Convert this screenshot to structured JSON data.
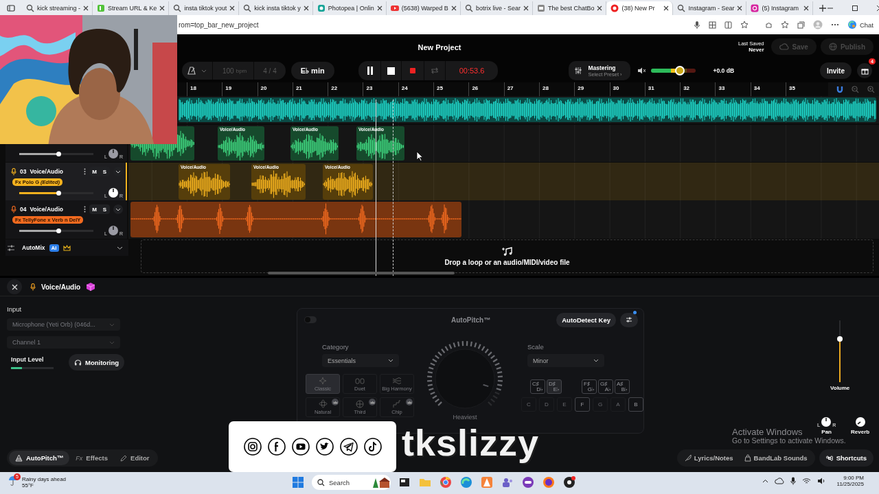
{
  "browser": {
    "tabs": [
      {
        "label": "kick streaming -",
        "selected": false
      },
      {
        "label": "Stream URL & Ke",
        "selected": false
      },
      {
        "label": "insta tiktok yout",
        "selected": false
      },
      {
        "label": "kick insta tiktok y",
        "selected": false
      },
      {
        "label": "Photopea | Onlin",
        "selected": false
      },
      {
        "label": "(5638) Warped B",
        "selected": false
      },
      {
        "label": "botrix live - Sear",
        "selected": false
      },
      {
        "label": "The best ChatBo",
        "selected": false
      },
      {
        "label": "(38) New Pr",
        "selected": true
      },
      {
        "label": "Instagram - Sear",
        "selected": false
      },
      {
        "label": "(5) Instagram",
        "selected": false
      }
    ],
    "address": "rom=top_bar_new_project",
    "chat": "Chat"
  },
  "project": {
    "title": "New Project",
    "last_saved_label": "Last Saved",
    "last_saved": "Never",
    "save": "Save",
    "publish": "Publish",
    "invite": "Invite",
    "gift_count": "4"
  },
  "transport": {
    "tempo": "100",
    "tempo_unit": "bpm",
    "meter": "4 / 4",
    "key": "E♭ min",
    "playing": true,
    "time": "00:53.6"
  },
  "mastering": {
    "label": "Mastering",
    "preset": "Select Preset ›"
  },
  "master_volume": {
    "level": 0.65,
    "reading": "+0.0 dB"
  },
  "ruler": [
    "18",
    "19",
    "20",
    "21",
    "22",
    "23",
    "24",
    "25",
    "26",
    "27",
    "28",
    "29",
    "30",
    "31",
    "32",
    "33",
    "34",
    "35"
  ],
  "tracks": [
    {
      "color": "#1fd6c9",
      "selected": false,
      "clips": [
        {
          "kind": "audio"
        }
      ]
    },
    {
      "color": "#3fd37e",
      "selected": false,
      "level": 0.54,
      "pan": {
        "left": "L",
        "right": "R"
      },
      "clips": [
        {
          "kind": "audio"
        },
        {
          "kind": "audio",
          "label": "Voice/Audio"
        },
        {
          "kind": "audio",
          "label": "Voice/Audio"
        },
        {
          "kind": "audio",
          "label": "Voice/Audio"
        }
      ]
    },
    {
      "color": "#f5b21e",
      "selected": true,
      "number": "03",
      "name": "Voice/Audio",
      "mute": "M",
      "solo": "S",
      "fx": "Fx Polo G *(Edited)*",
      "level": 0.54,
      "pan": {
        "left": "L",
        "right": "R"
      },
      "clips": [
        {
          "kind": "audio",
          "label": "Voice/Audio"
        },
        {
          "kind": "audio",
          "label": "Voice/Audio"
        },
        {
          "kind": "audio",
          "label": "Voice/Audio"
        }
      ]
    },
    {
      "color": "#f26a1f",
      "selected": false,
      "number": "04",
      "name": "Voice/Audio",
      "mute": "M",
      "solo": "S",
      "fx": "Fx TellyFone x Verb n DelY",
      "level": 0.54,
      "pan": {
        "left": "L",
        "right": "R"
      },
      "clips": [
        {
          "kind": "audio"
        }
      ]
    }
  ],
  "automix": {
    "label": "AutoMix",
    "badge": "AI",
    "expanded": false
  },
  "drop_zone": "Drop a loop or an audio/MIDI/video file",
  "editor": {
    "title": "Voice/Audio",
    "input_label": "Input",
    "device": "Microphone (Yeti Orb) (046d...",
    "channel": "Channel 1",
    "disabled": true,
    "input_level_label": "Input Level",
    "input_level": {
      "level": 0.25
    },
    "monitoring": "Monitoring",
    "autopitch": {
      "on": false,
      "title": "AutoPitch™",
      "autodetect": "AutoDetect Key",
      "category_label": "Category",
      "category": "Essentials",
      "presets": [
        {
          "label": "Classic",
          "premium": false,
          "selected": true
        },
        {
          "label": "Duet",
          "premium": false,
          "selected": false
        },
        {
          "label": "Big Harmony",
          "premium": false,
          "selected": false
        },
        {
          "label": "Natural",
          "premium": true,
          "selected": false
        },
        {
          "label": "Third",
          "premium": true,
          "selected": false
        },
        {
          "label": "Chip",
          "premium": true,
          "selected": false
        }
      ],
      "amount": {
        "level": 0.9
      },
      "amount_label": "Heaviest",
      "scale_label": "Scale",
      "scale": "Minor",
      "accidentals": [
        {
          "upper": "C♯",
          "lower": "D♭",
          "in_scale": true,
          "selected": false
        },
        {
          "upper": "D♯",
          "lower": "E♭",
          "in_scale": true,
          "selected": true
        },
        {
          "upper": "F♯",
          "lower": "G♭",
          "in_scale": true,
          "selected": false
        },
        {
          "upper": "G♯",
          "lower": "A♭",
          "in_scale": true,
          "selected": false
        },
        {
          "upper": "A♯",
          "lower": "B♭",
          "in_scale": true,
          "selected": false
        }
      ],
      "naturals": [
        {
          "label": "C",
          "in_scale": false
        },
        {
          "label": "D",
          "in_scale": false
        },
        {
          "label": "E",
          "in_scale": false
        },
        {
          "label": "F",
          "in_scale": true
        },
        {
          "label": "G",
          "in_scale": false
        },
        {
          "label": "A",
          "in_scale": false
        },
        {
          "label": "B",
          "in_scale": true
        }
      ]
    },
    "volume": {
      "label": "Volume",
      "level": 0.7
    },
    "pan": {
      "label": "Pan",
      "left": "L",
      "right": "R"
    },
    "reverb": {
      "label": "Reverb"
    },
    "tabs": [
      {
        "label": "AutoPitch™",
        "selected": true
      },
      {
        "label": "Effects",
        "glyph": "Fx",
        "selected": false
      },
      {
        "label": "Editor",
        "selected": false
      }
    ],
    "tools": [
      {
        "label": "Lyrics/Notes"
      },
      {
        "label": "BandLab Sounds"
      }
    ],
    "shortcuts": "Shortcuts"
  },
  "windows_notice": {
    "title": "Activate Windows",
    "body": "Go to Settings to activate Windows."
  },
  "stream_overlay": {
    "handle": "tkslizzy"
  },
  "taskbar": {
    "weather": {
      "title": "Rainy days ahead",
      "temp": "55°F",
      "badge": "5"
    },
    "search": "Search",
    "time": "9:00 PM",
    "date": "11/25/2025"
  }
}
